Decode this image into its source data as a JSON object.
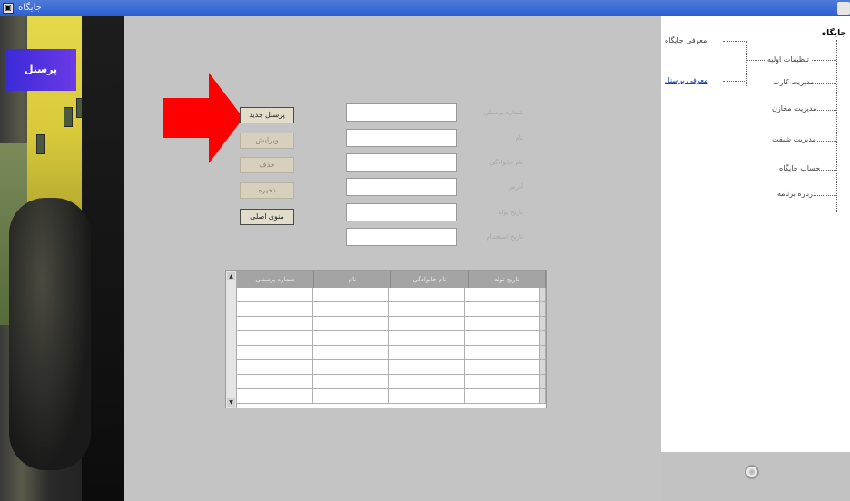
{
  "window": {
    "title": "جایگاه"
  },
  "sidebar_photo": {
    "label": "پرسنل"
  },
  "buttons": {
    "new": "پرسنل جدید",
    "edit": "ویرایش",
    "delete": "حذف",
    "save": "ذخیره",
    "back": "منوی اصلی"
  },
  "form": {
    "fields": [
      {
        "label": "شماره پرسنلی",
        "value": ""
      },
      {
        "label": "نام",
        "value": ""
      },
      {
        "label": "نام خانوادگی",
        "value": ""
      },
      {
        "label": "آدرس",
        "value": ""
      },
      {
        "label": "تاریخ تولد",
        "value": ""
      },
      {
        "label": "تاریخ استخدام",
        "value": ""
      }
    ]
  },
  "grid": {
    "columns": [
      "تاریخ تولد",
      "نام خانوادگی",
      "نام",
      "شماره پرسنلی"
    ]
  },
  "nav": {
    "root": "جایگاه",
    "branch": "معرفی جایگاه",
    "child_link": "معرفی پرسنل",
    "items": [
      "تنظیمات اولیه",
      "مدیریت کارت",
      "مدیریت مخازن",
      "مدیریت شیفت",
      "حساب جایگاه",
      "درباره برنامه"
    ]
  },
  "icons": {
    "app": "app-icon",
    "arrow": "red-arrow-icon",
    "settings": "gear-icon"
  },
  "colors": {
    "arrow": "#ff0000",
    "titlebar": "#2b5ed3",
    "link": "#1a3fa8"
  }
}
